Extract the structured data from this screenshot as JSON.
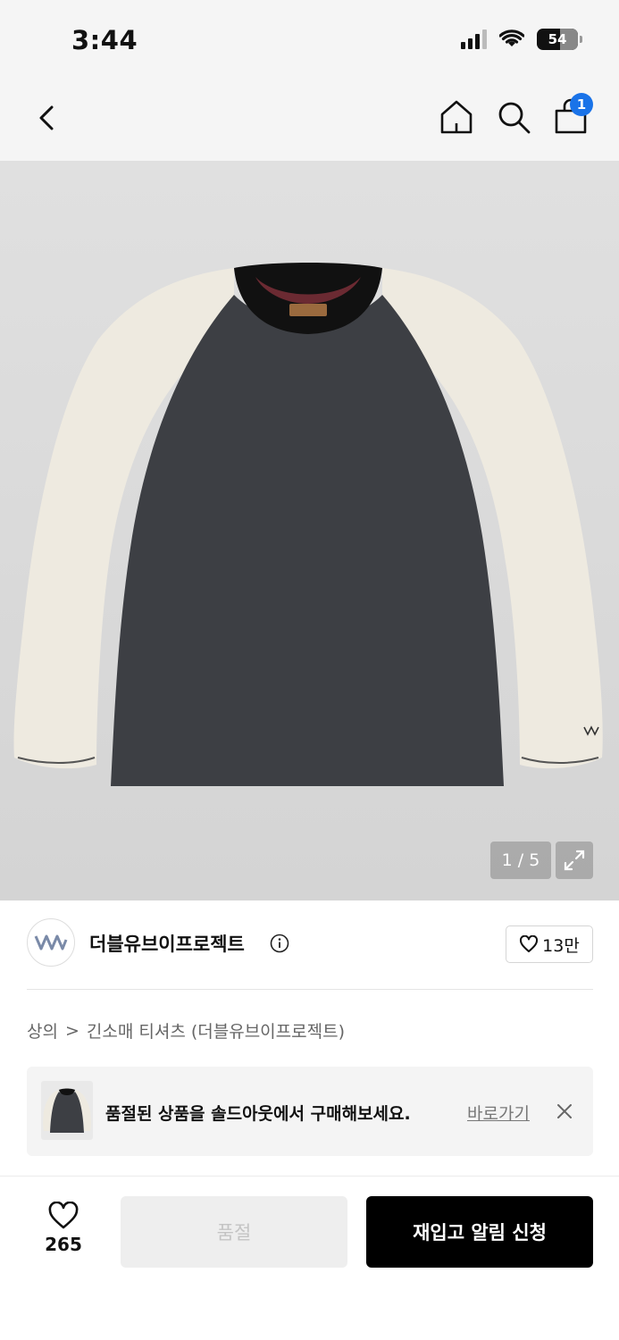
{
  "status_bar": {
    "time": "3:44",
    "battery": "54"
  },
  "nav": {
    "cart_count": "1"
  },
  "product_image": {
    "counter": "1 / 5"
  },
  "brand": {
    "name": "더블유브이프로젝트",
    "likes": "13만"
  },
  "breadcrumb": {
    "category": "상의",
    "separator": ">",
    "subcategory": "긴소매 티셔츠 (더블유브이프로젝트)"
  },
  "soldout_banner": {
    "message": "품절된 상품을 솔드아웃에서 구매해보세요.",
    "link_label": "바로가기"
  },
  "bottom_bar": {
    "wish_count": "265",
    "soldout_label": "품절",
    "restock_label": "재입고 알림 신청"
  },
  "icons": {
    "back": "chevron-left-icon",
    "home": "home-icon",
    "search": "search-icon",
    "cart": "shopping-bag-icon",
    "expand": "expand-icon",
    "info": "info-icon",
    "heart": "heart-icon",
    "close": "close-icon"
  },
  "colors": {
    "accent": "#1a73e8",
    "primary_button": "#000000",
    "disabled_button": "#eeeeee"
  }
}
